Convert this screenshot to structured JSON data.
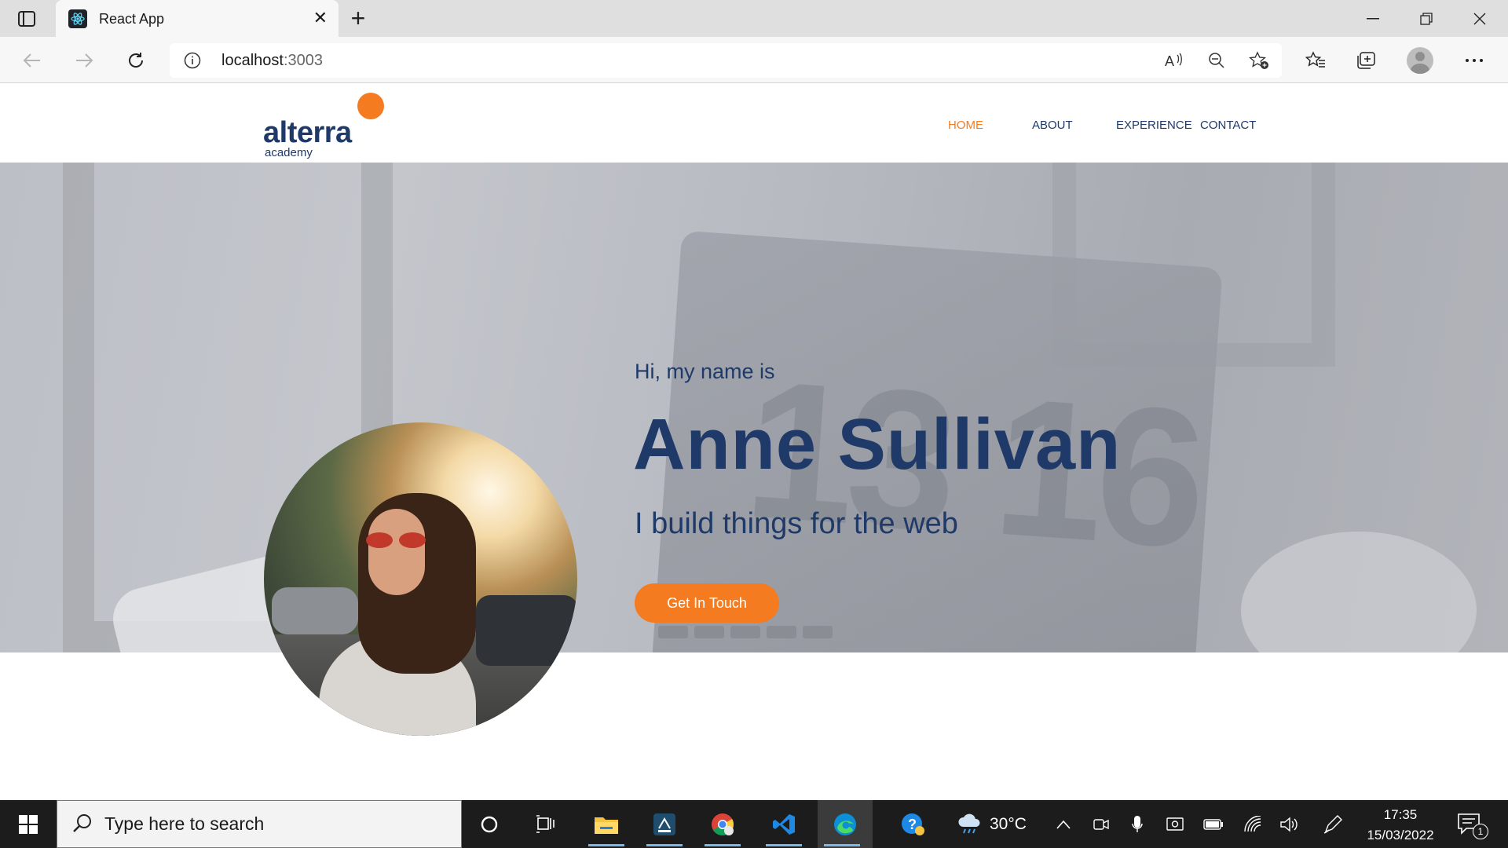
{
  "browser": {
    "tab_title": "React App",
    "url_host": "localhost",
    "url_port": ":3003"
  },
  "site": {
    "logo_word": "alterra",
    "logo_sub": "academy",
    "nav": [
      {
        "label": "HOME",
        "active": true
      },
      {
        "label": "ABOUT",
        "active": false
      },
      {
        "label": "EXPERIENCE",
        "active": false
      },
      {
        "label": "CONTACT",
        "active": false
      }
    ],
    "hero": {
      "greeting": "Hi, my name is",
      "name": "Anne Sullivan",
      "tagline": "I build things for the web",
      "cta_label": "Get In Touch"
    },
    "colors": {
      "accent": "#f47b20",
      "primary": "#1f3a68"
    }
  },
  "taskbar": {
    "search_placeholder": "Type here to search",
    "weather_temp": "30°C",
    "time": "17:35",
    "date": "15/03/2022",
    "notification_count": "1"
  }
}
